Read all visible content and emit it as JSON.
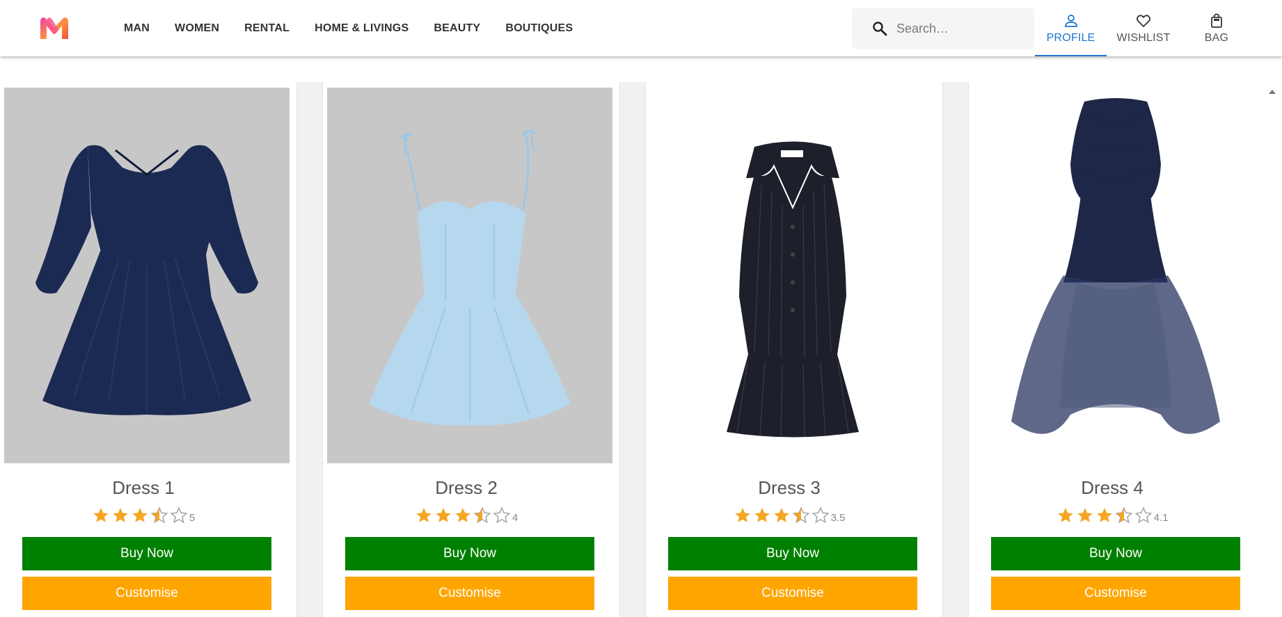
{
  "header": {
    "logo_name": "myntra-logo",
    "nav": [
      "MAN",
      "WOMEN",
      "RENTAL",
      "HOME & LIVINGS",
      "BEAUTY",
      "BOUTIQUES"
    ],
    "search": {
      "placeholder": "Search…",
      "value": ""
    },
    "actions": [
      {
        "label": "PROFILE",
        "icon": "person-icon",
        "active": true
      },
      {
        "label": "WISHLIST",
        "icon": "heart-icon",
        "active": false
      },
      {
        "label": "BAG",
        "icon": "bag-icon",
        "active": false
      }
    ],
    "accent_color": "#1976d2"
  },
  "products": [
    {
      "title": "Dress 1",
      "rating_label": "5",
      "stars": 3.5,
      "dress_color": "#1b2a52",
      "bg": "#c8c7c8",
      "buy_label": "Buy Now",
      "customise_label": "Customise"
    },
    {
      "title": "Dress 2",
      "rating_label": "4",
      "stars": 3.5,
      "dress_color": "#b5d8ee",
      "bg": "#c8c7c8",
      "buy_label": "Buy Now",
      "customise_label": "Customise"
    },
    {
      "title": "Dress 3",
      "rating_label": "3.5",
      "stars": 3.5,
      "dress_color": "#1d1f2a",
      "bg": "#ffffff",
      "buy_label": "Buy Now",
      "customise_label": "Customise"
    },
    {
      "title": "Dress 4",
      "rating_label": "4.1",
      "stars": 3.5,
      "dress_color": "#1e2748",
      "bg": "#ffffff",
      "buy_label": "Buy Now",
      "customise_label": "Customise"
    }
  ],
  "colors": {
    "buy_button": "#008000",
    "customise_button": "#ffa500",
    "star": "#f5a623"
  }
}
